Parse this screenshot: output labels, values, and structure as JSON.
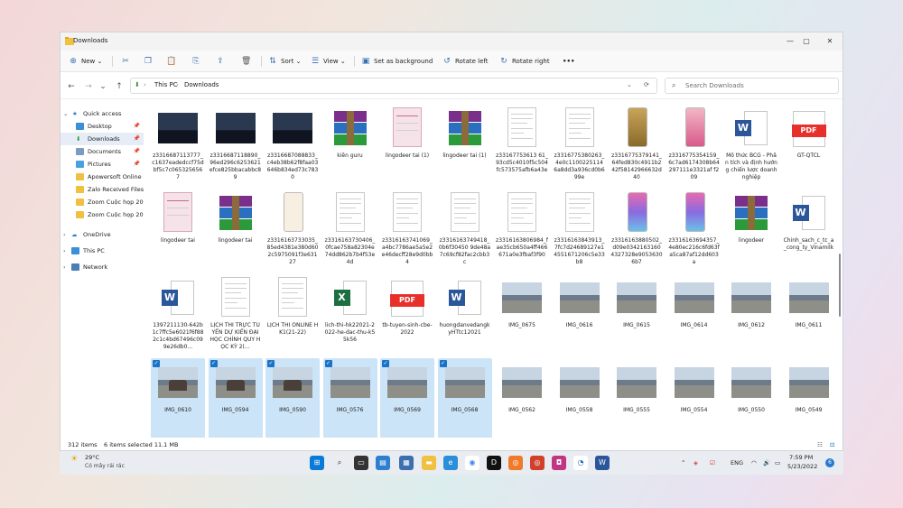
{
  "window": {
    "title": "Downloads"
  },
  "toolbar": {
    "new": "New",
    "sort": "Sort",
    "view": "View",
    "set_background": "Set as background",
    "rotate_left": "Rotate left",
    "rotate_right": "Rotate right",
    "more": "•••"
  },
  "address": {
    "this_pc": "This PC",
    "downloads": "Downloads",
    "search_placeholder": "Search Downloads"
  },
  "sidebar": {
    "quick_access": "Quick access",
    "items": [
      "Desktop",
      "Downloads",
      "Documents",
      "Pictures",
      "Apowersoft Online",
      "Zalo Received Files",
      "Zoom Cuộc họp 20...",
      "Zoom Cuộc họp 20..."
    ],
    "onedrive": "OneDrive",
    "this_pc": "This PC",
    "network": "Network"
  },
  "files": {
    "row1": [
      "z3316687113777_c1637eadedccf75dbf5c7c0653256567",
      "z3316687118890_96ed296c6253621efce825bbacabbc89",
      "z3316687088833_c4eb38b62f8faa03646b834ed73c7830",
      "kiến guru",
      "lingodeer tai (1)",
      "lingodeer tai (1)",
      "z33167753613 61_93cd5c4010f5c504fc573575afb6a43e",
      "z3316775380263_4e0c1100225114 6a8dd3a936cd0b699e",
      "z3316775379141_64fed830c4911b242f58142966632d40",
      "z3316775354159_6c7ad6174308b64297111e3321af f209",
      "Mô thức BCG - Phân tích và định hướng chiến lược doanh nghiệp",
      "GT-QTCL"
    ],
    "row2": [
      "lingodeer tai",
      "lingodeer tai",
      "z3316163733035_85ed4381e380d602c5975091f3e63127",
      "z3316163730406_0fcae758a82304e74dd862b7b4f53e4d",
      "z3316163741069_a4bc7786ae5a5e2e46decff28e9d0bb4",
      "z3316163749418_0b6f30450 9de48a7c69cf82fac2cbb3c",
      "z3316163806984_fae35cb650a4ff466671a0e3fbaf3f90",
      "z3316163843913_7fc7d24689127e14551671206c5e33b8",
      "z3316163880502_d09e0342163160 4327328e90536306b7",
      "z3316163694357_4e80ec216c6fd63fa5ca87af12dd603a",
      "lingodeer",
      "Chinh_sach_c_tc_a_cong_ty_Vinamilk"
    ],
    "row3": [
      "1397211130-642b1c7ffc5e6021f6f882c1c4bd67496c099e26db0...",
      "LỊCH THI TRỰC TUYẾN DỰ KIẾN ĐẠI HỌC CHÍNH QUY HỌC KỲ 2(...",
      "LỊCH THI ONLINE HK1(21-22)",
      "lich-thi-hk22021-2022-he-dac-thu-k55k56",
      "tb-tuyen-sinh-cbe-2022",
      "huongdanvedangkyHTtc12021",
      "IMG_0675",
      "IMG_0616",
      "IMG_0615",
      "IMG_0614",
      "IMG_0612",
      "IMG_0611"
    ],
    "row4": [
      "IMG_0610",
      "IMG_0594",
      "IMG_0590",
      "IMG_0576",
      "IMG_0569",
      "IMG_0568",
      "IMG_0562",
      "IMG_0558",
      "IMG_0555",
      "IMG_0554",
      "IMG_0550",
      "IMG_0549"
    ]
  },
  "status": {
    "items": "312 items",
    "selected": "6 items selected  11.1 MB"
  },
  "taskbar": {
    "temp": "29°C",
    "weather": "Có mây rải rác",
    "lang": "ENG",
    "time": "7:59 PM",
    "date": "5/23/2022",
    "notif": "6"
  },
  "colors": {
    "accent": "#0067c0",
    "selected_bg": "#cce4f7"
  }
}
